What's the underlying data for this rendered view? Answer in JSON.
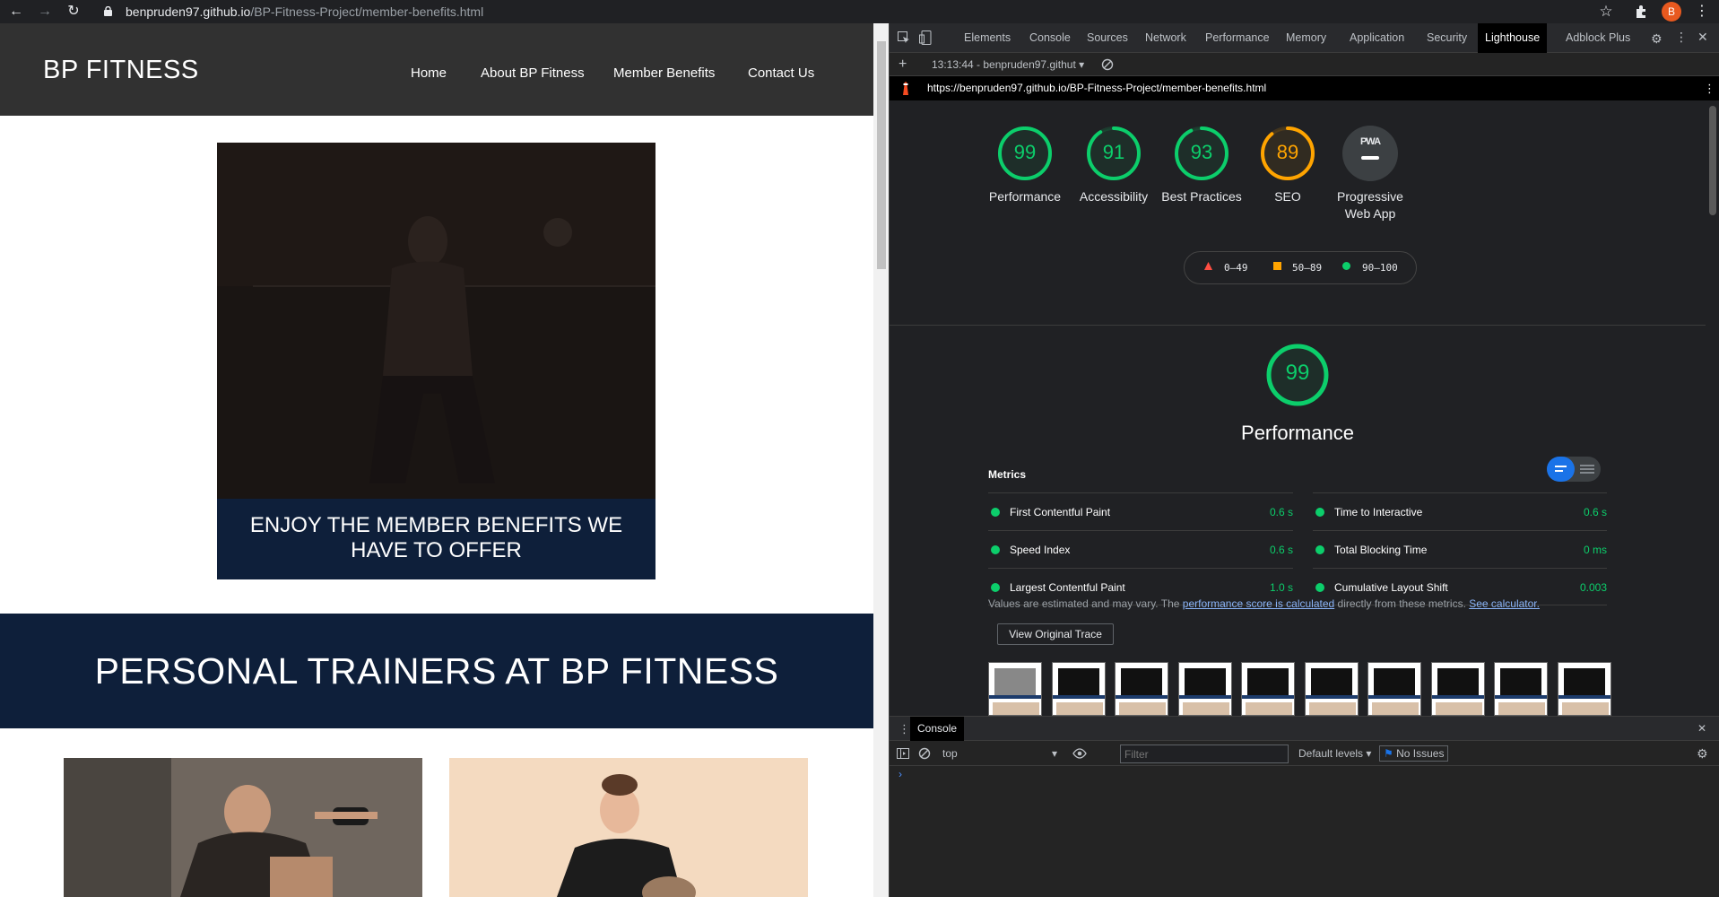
{
  "browser": {
    "url_host": "benpruden97.github.io",
    "url_path": "/BP-Fitness-Project/member-benefits.html",
    "profile_initial": "B"
  },
  "site": {
    "logo": "BP FITNESS",
    "nav": [
      "Home",
      "About BP Fitness",
      "Member Benefits",
      "Contact Us"
    ],
    "hero_caption": "ENJOY THE MEMBER BENEFITS WE HAVE TO OFFER",
    "trainers_heading": "PERSONAL TRAINERS AT BP FITNESS"
  },
  "devtools": {
    "tabs": [
      "Elements",
      "Console",
      "Sources",
      "Network",
      "Performance",
      "Memory",
      "Application",
      "Security",
      "Lighthouse",
      "Adblock Plus"
    ],
    "active_tab": "Lighthouse",
    "report_select": "13:13:44 - benpruden97.githut",
    "report_url": "https://benpruden97.github.io/BP-Fitness-Project/member-benefits.html",
    "scores": [
      {
        "label": "Performance",
        "score": "99",
        "color": "#0cce6b"
      },
      {
        "label": "Accessibility",
        "score": "91",
        "color": "#0cce6b"
      },
      {
        "label": "Best Practices",
        "score": "93",
        "color": "#0cce6b"
      },
      {
        "label": "SEO",
        "score": "89",
        "color": "#ffa400"
      },
      {
        "label": "Progressive Web App",
        "score": "PWA",
        "color": "#9aa0a6"
      }
    ],
    "legend": {
      "fail": "0–49",
      "average": "50–89",
      "pass": "90–100"
    },
    "perf_score": "99",
    "perf_title": "Performance",
    "metrics_label": "Metrics",
    "metrics": [
      {
        "name": "First Contentful Paint",
        "value": "0.6 s"
      },
      {
        "name": "Time to Interactive",
        "value": "0.6 s"
      },
      {
        "name": "Speed Index",
        "value": "0.6 s"
      },
      {
        "name": "Total Blocking Time",
        "value": "0 ms"
      },
      {
        "name": "Largest Contentful Paint",
        "value": "1.0 s"
      },
      {
        "name": "Cumulative Layout Shift",
        "value": "0.003"
      }
    ],
    "note_prefix": "Values are estimated and may vary. The ",
    "note_link1": "performance score is calculated",
    "note_mid": " directly from these metrics. ",
    "note_link2": "See calculator.",
    "view_trace": "View Original Trace",
    "drawer_tab": "Console",
    "console_context": "top",
    "filter_placeholder": "Filter",
    "levels": "Default levels",
    "issues": "No Issues"
  }
}
